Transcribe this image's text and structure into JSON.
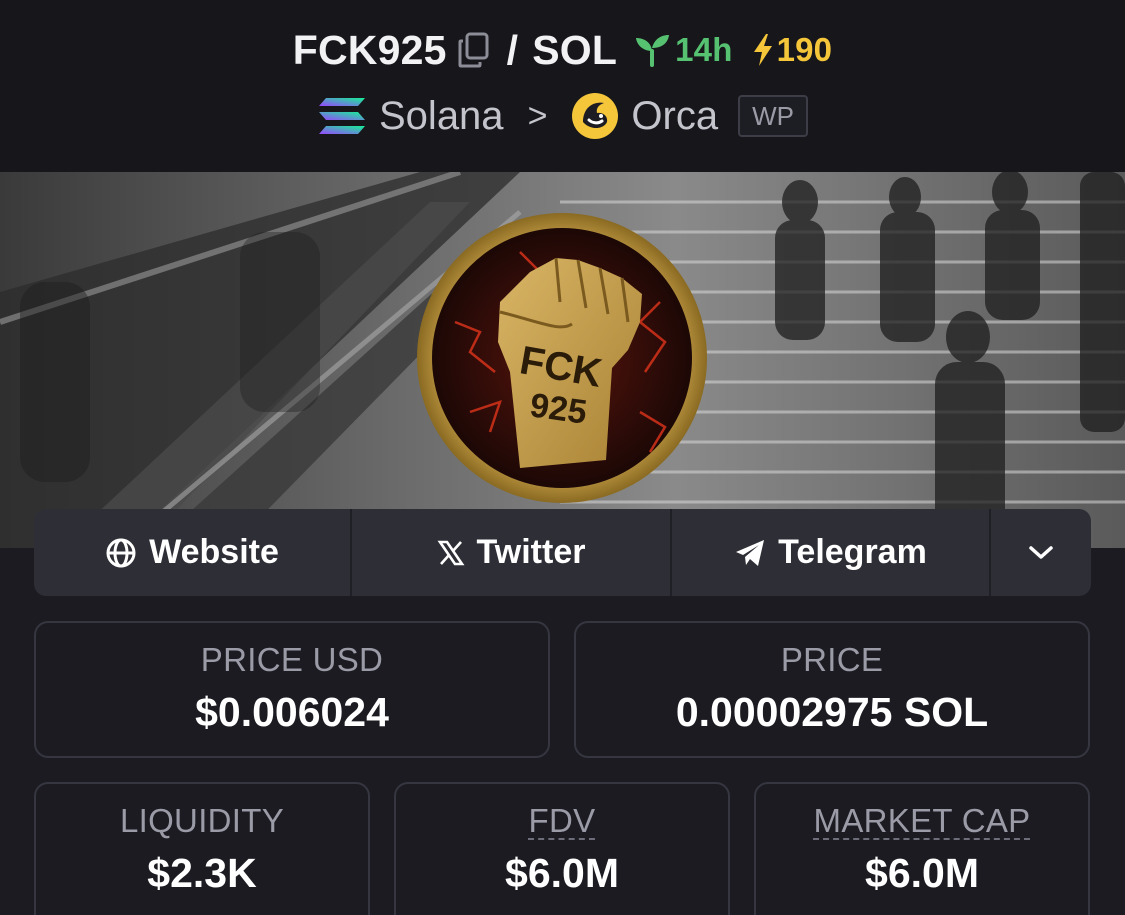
{
  "header": {
    "token_symbol": "FCK925",
    "separator": "/",
    "quote_symbol": "SOL",
    "pair_age": "14h",
    "boosts": "190",
    "chain": "Solana",
    "crumb_separator": ">",
    "dex": "Orca",
    "pool_badge": "WP"
  },
  "banner": {
    "logo_text_line1": "FCK",
    "logo_text_line2": "925"
  },
  "links": {
    "website": "Website",
    "twitter": "Twitter",
    "telegram": "Telegram"
  },
  "stats": {
    "price_usd": {
      "label": "PRICE USD",
      "value": "$0.006024"
    },
    "price": {
      "label": "PRICE",
      "value": "0.00002975 SOL"
    },
    "liquidity": {
      "label": "LIQUIDITY",
      "value": "$2.3K"
    },
    "fdv": {
      "label": "FDV",
      "value": "$6.0M"
    },
    "market_cap": {
      "label": "MARKET CAP",
      "value": "$6.0M"
    }
  },
  "colors": {
    "age_green": "#56c271",
    "boost_yellow": "#f5c53a",
    "background": "#1b1b21",
    "card_border": "#353640"
  },
  "icons": [
    "copy-icon",
    "seedling-icon",
    "lightning-icon",
    "solana-logo",
    "chevron-right-icon",
    "orca-logo",
    "globe-icon",
    "x-logo-icon",
    "telegram-icon",
    "chevron-down-icon"
  ]
}
